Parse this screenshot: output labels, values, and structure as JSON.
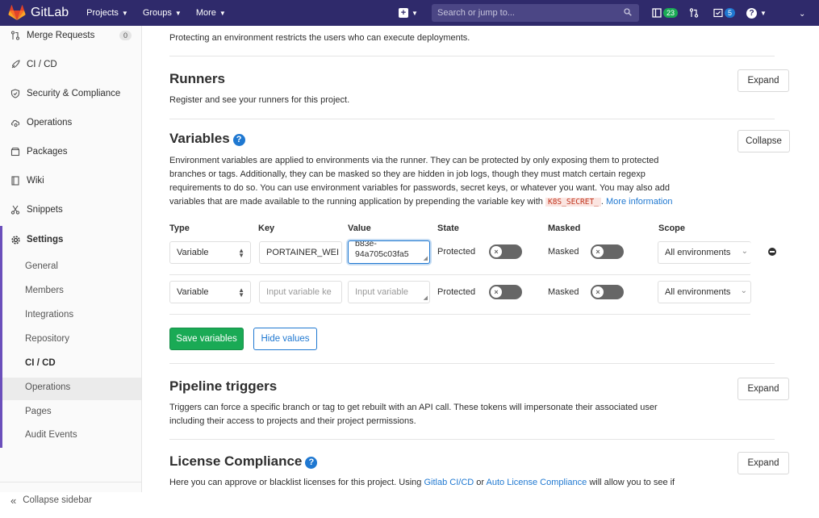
{
  "navbar": {
    "brand": "GitLab",
    "menus": [
      "Projects",
      "Groups",
      "More"
    ],
    "search_placeholder": "Search or jump to...",
    "todo_count": "23",
    "issues_count": "5",
    "colors": {
      "bg": "#2f2a6b",
      "green": "#1aaa55",
      "blue": "#1f78d1"
    }
  },
  "sidebar": {
    "items": [
      {
        "label": "Merge Requests",
        "count": "0",
        "icon": "merge-request-icon"
      },
      {
        "label": "CI / CD",
        "icon": "rocket-icon"
      },
      {
        "label": "Security & Compliance",
        "icon": "shield-icon"
      },
      {
        "label": "Operations",
        "icon": "cloud-gear-icon"
      },
      {
        "label": "Packages",
        "icon": "package-icon"
      },
      {
        "label": "Wiki",
        "icon": "book-icon"
      },
      {
        "label": "Snippets",
        "icon": "scissors-icon"
      },
      {
        "label": "Settings",
        "icon": "gear-icon"
      }
    ],
    "sub_items": [
      "General",
      "Members",
      "Integrations",
      "Repository",
      "CI / CD",
      "Operations",
      "Pages",
      "Audit Events"
    ],
    "collapse_label": "Collapse sidebar"
  },
  "sections": {
    "environments_desc": "Protecting an environment restricts the users who can execute deployments.",
    "runners": {
      "title": "Runners",
      "desc": "Register and see your runners for this project.",
      "button": "Expand"
    },
    "variables": {
      "title": "Variables",
      "button": "Collapse",
      "desc_1": "Environment variables are applied to environments via the runner. They can be protected by only exposing them to protected",
      "desc_2": "branches or tags. Additionally, they can be masked so they are hidden in job logs, though they must match certain regexp",
      "desc_3": "requirements to do so. You can use environment variables for passwords, secret keys, or whatever you want. You may also add",
      "desc_4": "variables that are made available to the running application by prepending the variable key with",
      "code": "K8S_SECRET_",
      "more_info": "More information",
      "headers": {
        "type": "Type",
        "key": "Key",
        "value": "Value",
        "state": "State",
        "masked": "Masked",
        "scope": "Scope"
      },
      "rows": [
        {
          "type": "Variable",
          "key": "PORTAINER_WEI",
          "value_1": "b83e-",
          "value_2": "94a705c03fa5",
          "state": "Protected",
          "masked": "Masked",
          "scope": "All environments"
        },
        {
          "type": "Variable",
          "key_placeholder": "Input variable ke",
          "value_placeholder": "Input variable",
          "state": "Protected",
          "masked": "Masked",
          "scope": "All environments"
        }
      ],
      "save_button": "Save variables",
      "hide_button": "Hide values"
    },
    "pipeline_triggers": {
      "title": "Pipeline triggers",
      "desc_1": "Triggers can force a specific branch or tag to get rebuilt with an API call. These tokens will impersonate their associated user",
      "desc_2": "including their access to projects and their project permissions.",
      "button": "Expand"
    },
    "license_compliance": {
      "title": "License Compliance",
      "desc_pre": "Here you can approve or blacklist licenses for this project. Using",
      "link_1": "Gitlab CI/CD",
      "desc_mid": "or",
      "link_2": "Auto License Compliance",
      "desc_post": "will allow you to see if",
      "button": "Expand"
    }
  }
}
